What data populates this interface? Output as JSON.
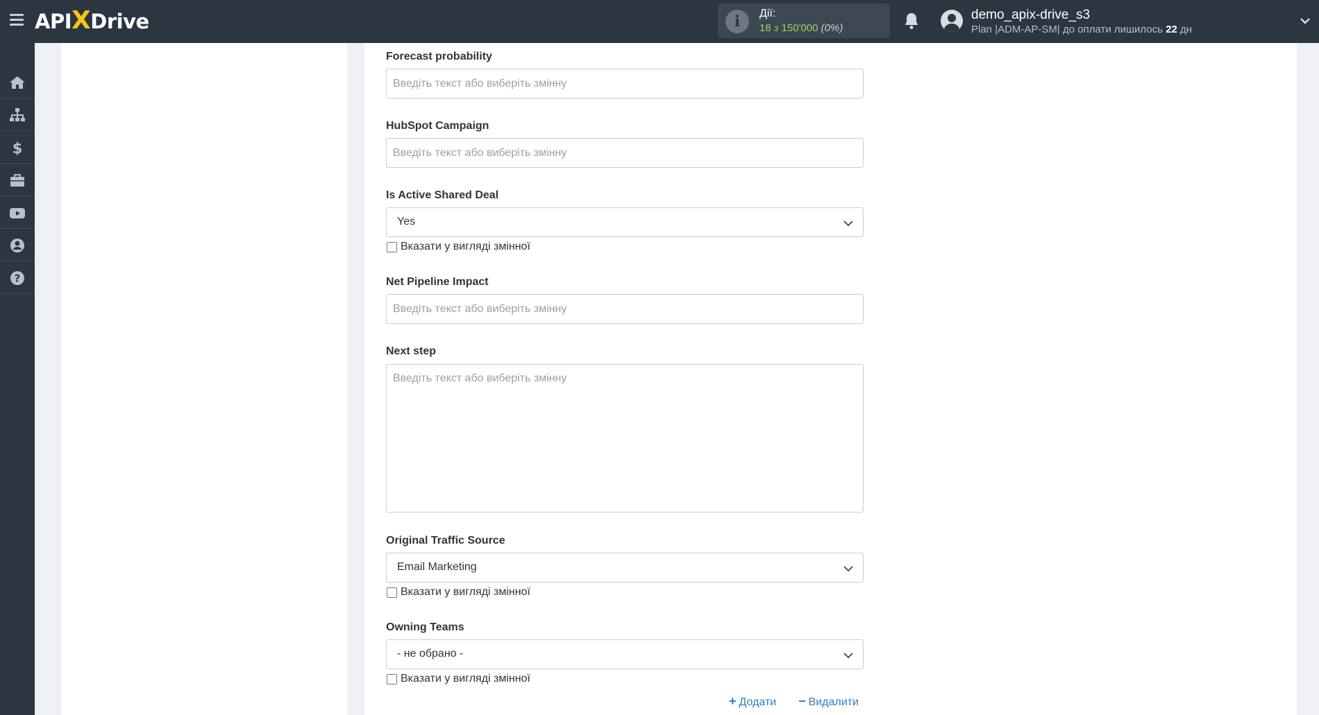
{
  "header": {
    "logo": {
      "part1": "API",
      "x": "X",
      "part2": "Drive"
    },
    "actions": {
      "label": "Дії:",
      "used": "18",
      "of": "з",
      "total": "150'000",
      "percent": "(0%)"
    },
    "user": {
      "name": "demo_apix-drive_s3",
      "plan_prefix": "Plan |ADM-AP-SM| до оплати лишилось ",
      "days": "22",
      "days_suffix": " дн"
    }
  },
  "sidebar": {
    "items": [
      "home-icon",
      "sitemap-icon",
      "dollar-icon",
      "briefcase-icon",
      "youtube-icon",
      "user-circle-icon",
      "question-icon"
    ]
  },
  "form": {
    "forecast_probability": {
      "label": "Forecast probability",
      "placeholder": "Введіть текст або виберіть змінну",
      "value": ""
    },
    "hubspot_campaign": {
      "label": "HubSpot Campaign",
      "placeholder": "Введіть текст або виберіть змінну",
      "value": ""
    },
    "is_active_shared_deal": {
      "label": "Is Active Shared Deal",
      "selected": "Yes",
      "checkbox_label": "Вказати у вигляді змінної"
    },
    "net_pipeline_impact": {
      "label": "Net Pipeline Impact",
      "placeholder": "Введіть текст або виберіть змінну",
      "value": ""
    },
    "next_step": {
      "label": "Next step",
      "placeholder": "Введіть текст або виберіть змінну",
      "value": ""
    },
    "original_traffic_source": {
      "label": "Original Traffic Source",
      "selected": "Email Marketing",
      "checkbox_label": "Вказати у вигляді змінної"
    },
    "owning_teams": {
      "label": "Owning Teams",
      "selected": "- не обрано -",
      "checkbox_label": "Вказати у вигляді змінної"
    },
    "add_label": "Додати",
    "remove_label": "Видалити"
  },
  "colors": {
    "topbar": "#2b3641",
    "accent_logo": "#f5c518",
    "actions_green": "#9ed15a",
    "link_blue": "#2d7ec1"
  }
}
